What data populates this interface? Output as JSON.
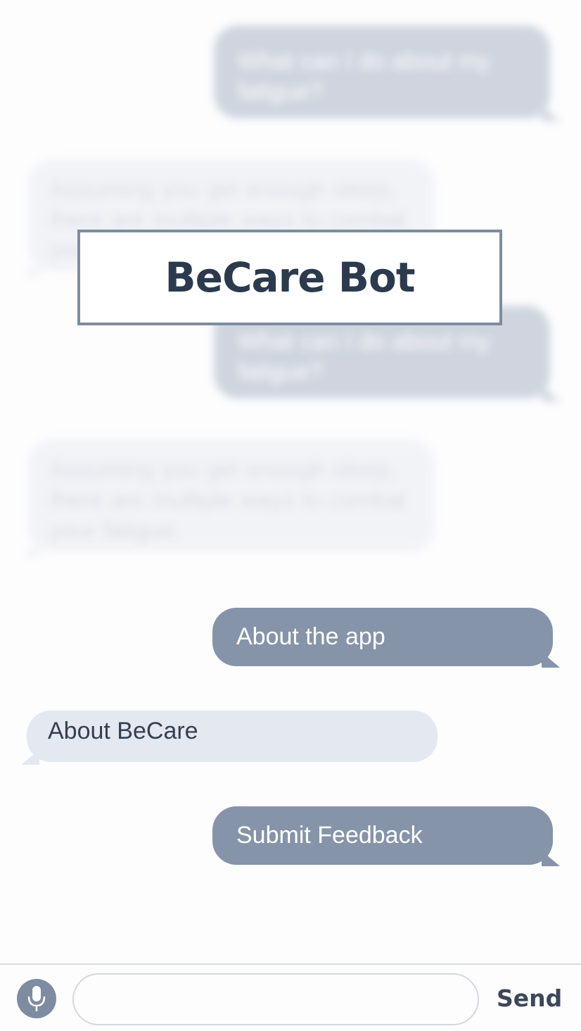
{
  "app": {
    "title": "BeCare Bot"
  },
  "background_chat": [
    {
      "side": "out",
      "text": "What can I do about my fatigue?"
    },
    {
      "side": "in",
      "text": "Assuming you get enough sleep, there are multiple ways to combat your fatigue."
    },
    {
      "side": "out",
      "text": "What can I do about my fatigue?"
    },
    {
      "side": "in",
      "text": "Assuming you get enough sleep, there are multiple ways to combat your fatigue."
    }
  ],
  "options": {
    "about_app": "About the app",
    "about_becare": "About BeCare",
    "submit_feedback": "Submit Feedback"
  },
  "composer": {
    "placeholder": "",
    "value": "",
    "send_label": "Send",
    "mic_icon": "microphone-icon"
  },
  "colors": {
    "accent": "#8594a8",
    "incoming": "#e4e8f1",
    "title_text": "#2c3a4d"
  }
}
